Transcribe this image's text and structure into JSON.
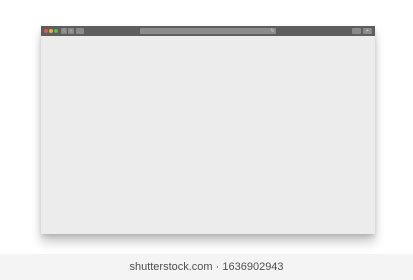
{
  "window": {
    "traffic_lights": {
      "close_color": "#e05a4e",
      "minimize_color": "#e0b23b",
      "zoom_color": "#5fba46"
    },
    "toolbar": {
      "back_icon": "chevron-left-icon",
      "forward_icon": "chevron-right-icon",
      "tab_icon": "sidebar-icon",
      "reload_icon": "reload-icon",
      "share_icon": "share-icon",
      "add_tab_icon": "plus-icon",
      "address_value": ""
    },
    "colors": {
      "titlebar": "#5e5e5e",
      "content": "#ececec"
    }
  },
  "watermark": {
    "text": "shutterstock.com · 1636902943"
  }
}
